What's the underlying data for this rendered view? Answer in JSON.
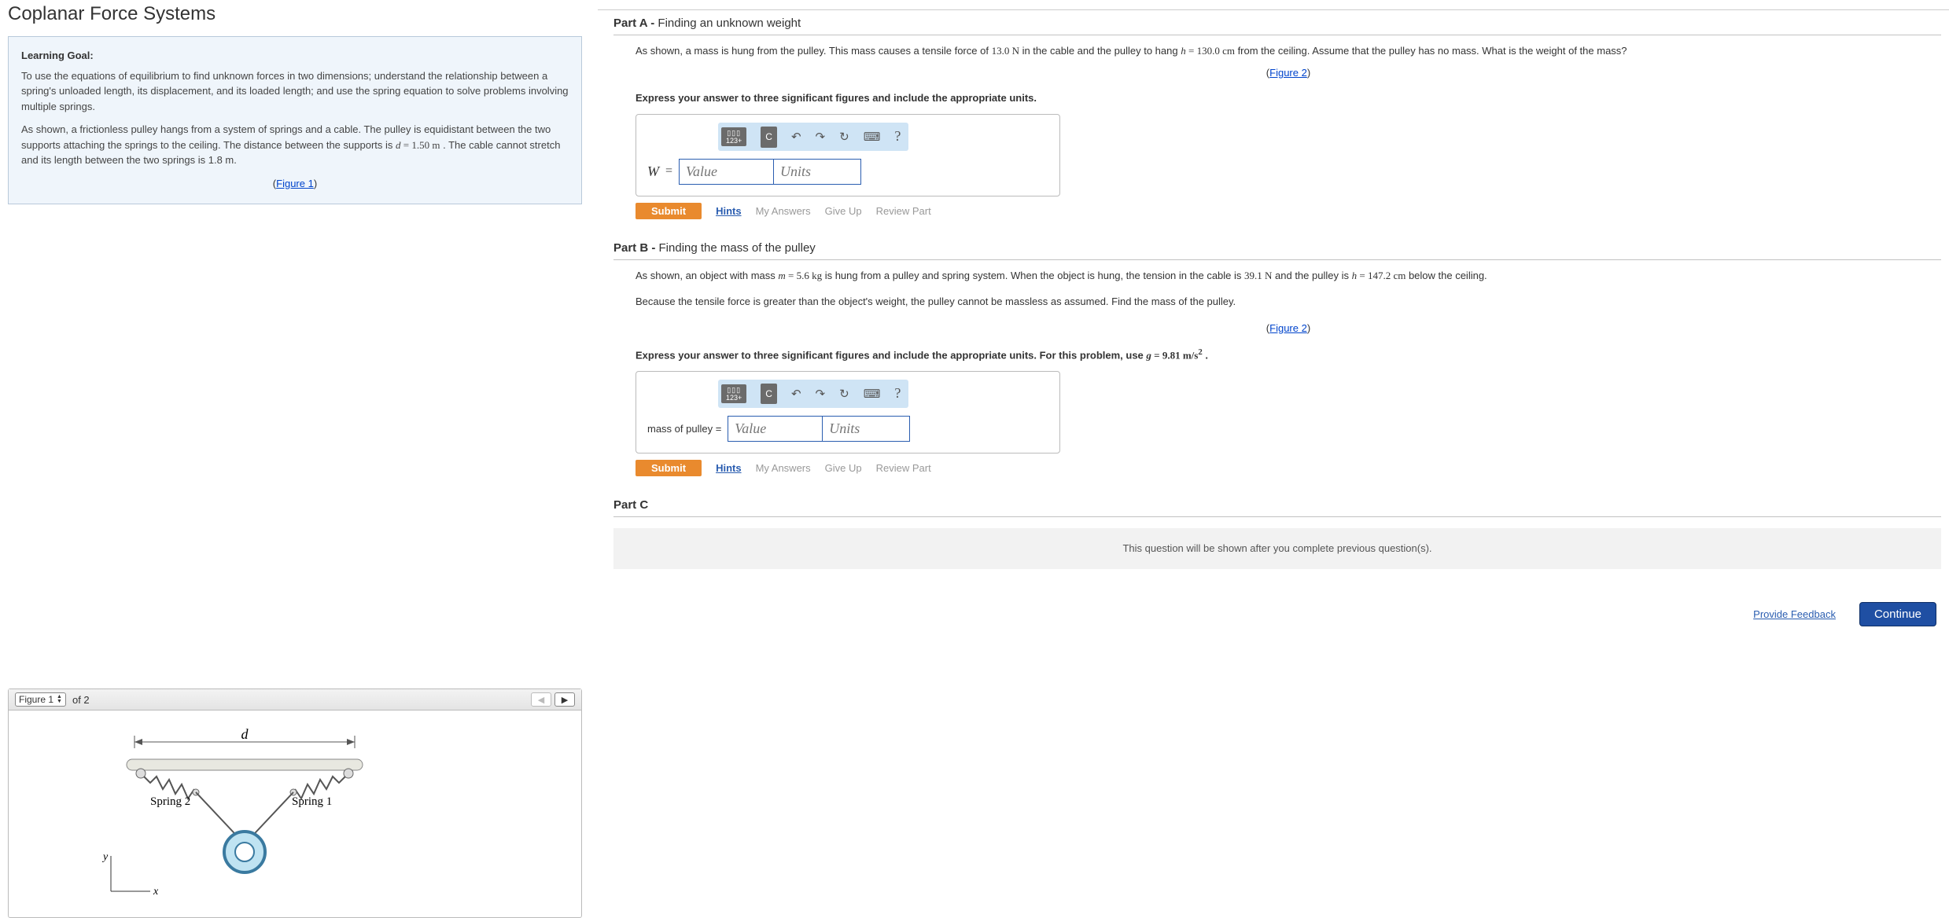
{
  "title": "Coplanar Force Systems",
  "learning": {
    "heading": "Learning Goal:",
    "goal": "To use the equations of equilibrium to find unknown forces in two dimensions; understand the relationship between a spring's unloaded length, its displacement, and its loaded length; and use the spring equation to solve problems involving multiple springs.",
    "scenario_pre": "As shown, a frictionless pulley hangs from a system of springs and a cable. The pulley is equidistant between the two supports attaching the springs to the ceiling. The distance between the supports is ",
    "scenario_d_var": "d",
    "scenario_d_eq": " = ",
    "scenario_d_val": "1.50 m",
    "scenario_mid": " . The cable cannot stretch and its length between the two springs is 1.8 m.",
    "figure1_link": "Figure 1"
  },
  "figure_panel": {
    "selector_label": "Figure 1",
    "count_label": "of 2",
    "labels": {
      "d": "d",
      "s1": "Spring 1",
      "s2": "Spring 2",
      "x": "x",
      "y": "y"
    }
  },
  "partA": {
    "label": "Part A -",
    "title": "Finding an unknown weight",
    "text_pre": "As shown, a mass is hung from the pulley. This mass causes a tensile force of ",
    "force": "13.0 N",
    "text_mid1": " in the cable and the pulley to hang ",
    "h_var": "h",
    "h_eq": " = ",
    "h_val": "130.0 cm",
    "text_post": " from the ceiling. Assume that the pulley has no mass. What is the weight of the mass?",
    "figure2_link": "Figure 2",
    "instruction": "Express your answer to three significant figures and include the appropriate units.",
    "answer_var": "W",
    "value_ph": "Value",
    "units_ph": "Units"
  },
  "partB": {
    "label": "Part B -",
    "title": "Finding the mass of the pulley",
    "text1_pre": "As shown, an object with mass ",
    "m_var": "m",
    "m_eq": " = ",
    "m_val": "5.6 kg",
    "text1_mid": " is hung from a pulley and spring system. When the object is hung, the tension in the cable is ",
    "tension": "39.1 N",
    "text1_mid2": " and the pulley is ",
    "h_var": "h",
    "h_eq": " = ",
    "h_val": "147.2 cm",
    "text1_post": " below the ceiling.",
    "text2": "Because the tensile force is greater than the object's weight, the pulley cannot be massless as assumed. Find the mass of the pulley.",
    "figure2_link": "Figure 2",
    "instruction_pre": "Express your answer to three significant figures and include the appropriate units. For this problem, use ",
    "g_var": "g",
    "g_eq": " = ",
    "g_val_num": "9.81",
    "g_val_unit": " m/s",
    "g_val_exp": "2",
    "instruction_post": " .",
    "answer_label": "mass of pulley =",
    "value_ph": "Value",
    "units_ph": "Units"
  },
  "partC": {
    "label": "Part C",
    "message": "This question will be shown after you complete previous question(s)."
  },
  "actions": {
    "submit": "Submit",
    "hints": "Hints",
    "my_answers": "My Answers",
    "give_up": "Give Up",
    "review": "Review Part"
  },
  "footer": {
    "feedback": "Provide Feedback",
    "continue": "Continue"
  },
  "toolbar": {
    "tmpl_top": "▯▯▯",
    "tmpl_bot": "123+",
    "c": "C",
    "undo": "↶",
    "redo": "↷",
    "reset": "↻",
    "keyboard": "⌨",
    "help": "?"
  }
}
